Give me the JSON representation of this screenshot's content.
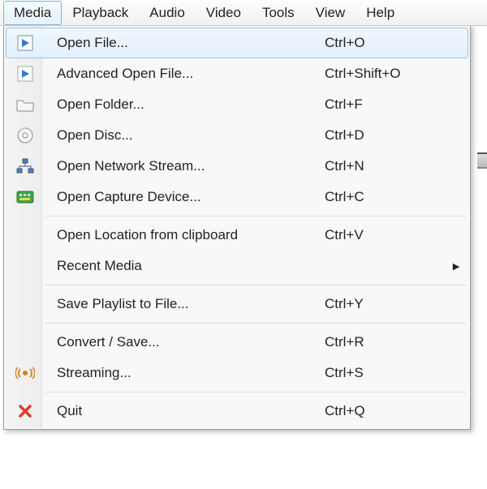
{
  "menubar": {
    "items": [
      {
        "label": "Media",
        "active": true
      },
      {
        "label": "Playback"
      },
      {
        "label": "Audio"
      },
      {
        "label": "Video"
      },
      {
        "label": "Tools"
      },
      {
        "label": "View"
      },
      {
        "label": "Help"
      }
    ]
  },
  "dropdown": {
    "items": [
      {
        "label": "Open File...",
        "shortcut": "Ctrl+O",
        "icon": "play-file-icon",
        "highlight": true
      },
      {
        "label": "Advanced Open File...",
        "shortcut": "Ctrl+Shift+O",
        "icon": "play-file-icon"
      },
      {
        "label": "Open Folder...",
        "shortcut": "Ctrl+F",
        "icon": "folder-icon"
      },
      {
        "label": "Open Disc...",
        "shortcut": "Ctrl+D",
        "icon": "disc-icon"
      },
      {
        "label": "Open Network Stream...",
        "shortcut": "Ctrl+N",
        "icon": "network-icon"
      },
      {
        "label": "Open Capture Device...",
        "shortcut": "Ctrl+C",
        "icon": "capture-icon"
      },
      {
        "separator": true
      },
      {
        "label": "Open Location from clipboard",
        "shortcut": "Ctrl+V"
      },
      {
        "label": "Recent Media",
        "submenu": true
      },
      {
        "separator": true
      },
      {
        "label": "Save Playlist to File...",
        "shortcut": "Ctrl+Y"
      },
      {
        "separator": true
      },
      {
        "label": "Convert / Save...",
        "shortcut": "Ctrl+R"
      },
      {
        "label": "Streaming...",
        "shortcut": "Ctrl+S",
        "icon": "stream-icon"
      },
      {
        "separator": true
      },
      {
        "label": "Quit",
        "shortcut": "Ctrl+Q",
        "icon": "quit-icon"
      }
    ]
  },
  "submenu_arrow": "▶"
}
